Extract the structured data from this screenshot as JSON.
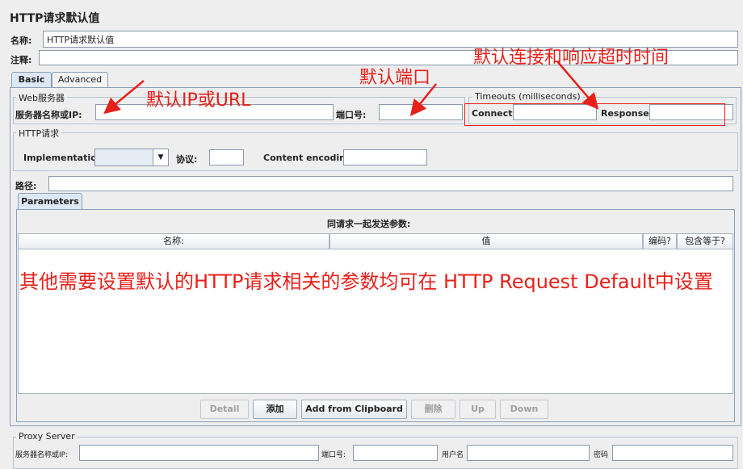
{
  "page": {
    "title": "HTTP请求默认值"
  },
  "name_field": {
    "label": "名称:",
    "value": "HTTP请求默认值"
  },
  "comment_field": {
    "label": "注释:",
    "value": ""
  },
  "tabs": [
    {
      "label": "Basic",
      "selected": true
    },
    {
      "label": "Advanced",
      "selected": false
    }
  ],
  "web_server": {
    "legend": "Web服务器",
    "server_label": "服务器名称或IP:",
    "server_value": "",
    "port_label": "端口号:",
    "port_value": ""
  },
  "timeouts": {
    "legend": "Timeouts (milliseconds)",
    "connect_label": "Connect:",
    "connect_value": "",
    "response_label": "Response:",
    "response_value": ""
  },
  "http_request": {
    "legend": "HTTP请求",
    "implementation_label": "Implementation:",
    "implementation_value": "",
    "protocol_label": "协议:",
    "protocol_value": "",
    "encoding_label": "Content encoding:",
    "encoding_value": "",
    "path_label": "路径:",
    "path_value": ""
  },
  "parameters": {
    "tab_label": "Parameters",
    "caption": "同请求一起发送参数:",
    "columns": [
      "名称:",
      "值",
      "编码?",
      "包含等于?"
    ],
    "rows": []
  },
  "buttons": [
    {
      "label": "Detail",
      "enabled": false
    },
    {
      "label": "添加",
      "enabled": true
    },
    {
      "label": "Add from Clipboard",
      "enabled": true
    },
    {
      "label": "删除",
      "enabled": false
    },
    {
      "label": "Up",
      "enabled": false
    },
    {
      "label": "Down",
      "enabled": false
    }
  ],
  "proxy": {
    "legend": "Proxy Server",
    "server_label": "服务器名称或IP:",
    "port_label": "端口号:",
    "username_label": "用户名",
    "password_label": "密码"
  },
  "annotations": {
    "default_ip": "默认IP或URL",
    "default_port": "默认端口",
    "default_timeout": "默认连接和响应超时时间",
    "note": "其他需要设置默认的HTTP请求相关的参数均可在 HTTP Request Default中设置"
  },
  "colors": {
    "annotation": "#e8201a",
    "background": "#eeeeee",
    "tab_selected": "#dde8f4"
  }
}
